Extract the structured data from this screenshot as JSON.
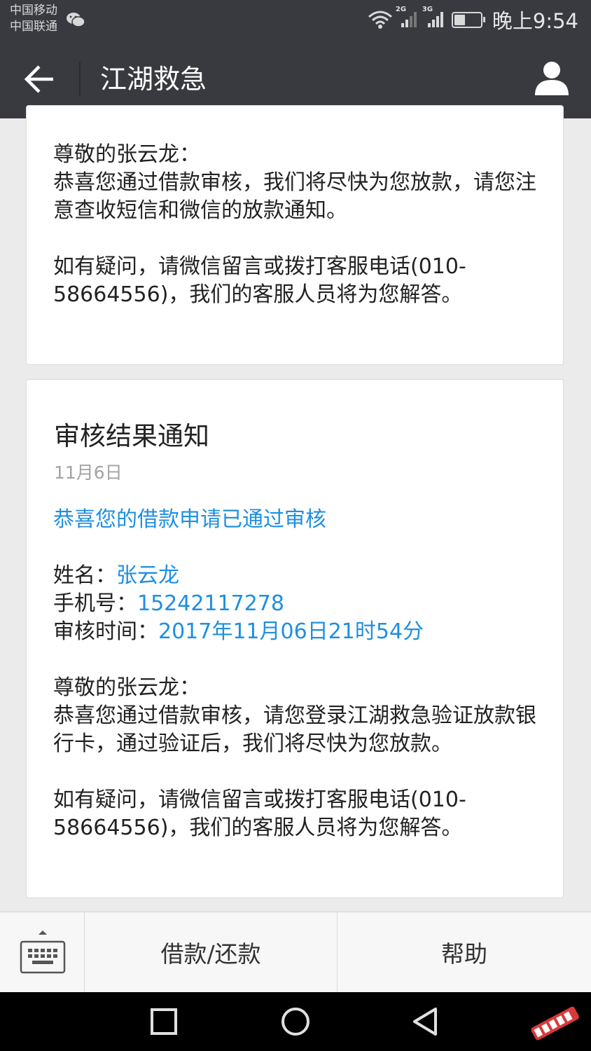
{
  "status_bar": {
    "carrier_1": "中国移动",
    "carrier_2": "中国联通",
    "network_1": "2G",
    "network_2": "3G",
    "battery_level": 0.45,
    "time": "晚上9:54"
  },
  "header": {
    "title": "江湖救急"
  },
  "message_1": {
    "greeting": "尊敬的张云龙：",
    "body": "恭喜您通过借款审核，我们将尽快为您放款，请您注意查收短信和微信的放款通知。",
    "help": "如有疑问，请微信留言或拨打客服电话(010-58664556)，我们的客服人员将为您解答。"
  },
  "message_2": {
    "title": "审核结果通知",
    "date": "11月6日",
    "headline": "恭喜您的借款申请已通过审核",
    "name_label": "姓名：",
    "name_value": "张云龙",
    "phone_label": "手机号：",
    "phone_value": "15242117278",
    "time_label": "审核时间：",
    "time_value": "2017年11月06日21时54分",
    "greeting": "尊敬的张云龙：",
    "body": "恭喜您通过借款审核，请您登录江湖救急验证放款银行卡，通过验证后，我们将尽快为您放款。",
    "help": "如有疑问，请微信留言或拨打客服电话(010-58664556)，我们的客服人员将为您解答。"
  },
  "menu": {
    "item_1": "借款/还款",
    "item_2": "帮助"
  },
  "colors": {
    "bar": "#393a3f",
    "link_blue": "#1f8fe0",
    "background": "#ebebeb"
  },
  "icons": [
    "wechat-icon",
    "wifi-icon",
    "signal-icon",
    "battery-icon",
    "back-arrow-icon",
    "profile-icon",
    "keyboard-icon",
    "nav-square-icon",
    "nav-circle-icon",
    "nav-back-icon",
    "watermark-logo"
  ]
}
